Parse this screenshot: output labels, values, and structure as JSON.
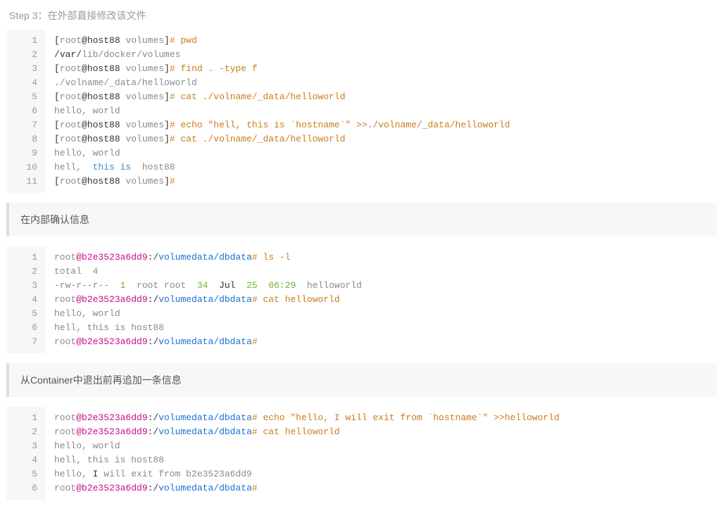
{
  "step_title": "Step 3：在外部直接修改该文件",
  "callout1": "在内部确认信息",
  "callout2": "从Container中退出前再追加一条信息",
  "block1": {
    "lines": [
      [
        {
          "cls": "tok-bracket",
          "t": "["
        },
        {
          "cls": "tok-grey mono-small",
          "t": "root"
        },
        {
          "cls": "tok-at",
          "t": "@host88 "
        },
        {
          "cls": "tok-grey mono-small",
          "t": "volumes"
        },
        {
          "cls": "tok-bracket",
          "t": "]"
        },
        {
          "cls": "tok-hash",
          "t": "# "
        },
        {
          "cls": "tok-cmd",
          "t": "pwd"
        }
      ],
      [
        {
          "cls": "tok-plain",
          "t": "/"
        },
        {
          "cls": "tok-plain",
          "t": "var"
        },
        {
          "cls": "tok-plain",
          "t": "/"
        },
        {
          "cls": "tok-grey mono-small",
          "t": "lib/docker/volumes"
        }
      ],
      [
        {
          "cls": "tok-bracket",
          "t": "["
        },
        {
          "cls": "tok-grey mono-small",
          "t": "root"
        },
        {
          "cls": "tok-at",
          "t": "@host88 "
        },
        {
          "cls": "tok-grey mono-small",
          "t": "volumes"
        },
        {
          "cls": "tok-bracket",
          "t": "]"
        },
        {
          "cls": "tok-hash",
          "t": "# "
        },
        {
          "cls": "tok-cmd",
          "t": "find . -type f"
        }
      ],
      [
        {
          "cls": "tok-grey mono-small",
          "t": "./volname/_data/helloworld"
        }
      ],
      [
        {
          "cls": "tok-bracket",
          "t": "["
        },
        {
          "cls": "tok-grey mono-small",
          "t": "root"
        },
        {
          "cls": "tok-at",
          "t": "@host88 "
        },
        {
          "cls": "tok-grey mono-small",
          "t": "volumes"
        },
        {
          "cls": "tok-bracket",
          "t": "]"
        },
        {
          "cls": "tok-hash",
          "t": "# "
        },
        {
          "cls": "tok-cmd",
          "t": "cat ./volname/_data/helloworld"
        }
      ],
      [
        {
          "cls": "tok-grey mono-small",
          "t": "hello, world"
        }
      ],
      [
        {
          "cls": "tok-bracket",
          "t": "["
        },
        {
          "cls": "tok-grey mono-small",
          "t": "root"
        },
        {
          "cls": "tok-at",
          "t": "@host88 "
        },
        {
          "cls": "tok-grey mono-small",
          "t": "volumes"
        },
        {
          "cls": "tok-bracket",
          "t": "]"
        },
        {
          "cls": "tok-hash",
          "t": "# "
        },
        {
          "cls": "tok-cmd",
          "t": "echo \"hell, this is `hostname`\" >>./volname/_data/helloworld"
        }
      ],
      [
        {
          "cls": "tok-bracket",
          "t": "["
        },
        {
          "cls": "tok-grey mono-small",
          "t": "root"
        },
        {
          "cls": "tok-at",
          "t": "@host88 "
        },
        {
          "cls": "tok-grey mono-small",
          "t": "volumes"
        },
        {
          "cls": "tok-bracket",
          "t": "]"
        },
        {
          "cls": "tok-hash",
          "t": "# "
        },
        {
          "cls": "tok-cmd",
          "t": "cat ./volname/_data/helloworld"
        }
      ],
      [
        {
          "cls": "tok-grey mono-small",
          "t": "hello, world"
        }
      ],
      [
        {
          "cls": "tok-grey mono-small",
          "t": "hell, "
        },
        {
          "cls": "tok-kw",
          "t": " this"
        },
        {
          "cls": "tok-kw",
          "t": " is "
        },
        {
          "cls": "tok-grey mono-small",
          "t": " host88"
        }
      ],
      [
        {
          "cls": "tok-bracket",
          "t": "["
        },
        {
          "cls": "tok-grey mono-small",
          "t": "root"
        },
        {
          "cls": "tok-at",
          "t": "@host88 "
        },
        {
          "cls": "tok-grey mono-small",
          "t": "volumes"
        },
        {
          "cls": "tok-bracket",
          "t": "]"
        },
        {
          "cls": "tok-hash",
          "t": "#"
        }
      ]
    ]
  },
  "block2": {
    "lines": [
      [
        {
          "cls": "tok-grey mono-small",
          "t": "root"
        },
        {
          "cls": "tok-host",
          "t": "@b2e3523a6dd9"
        },
        {
          "cls": "tok-plain",
          "t": ":/"
        },
        {
          "cls": "tok-path",
          "t": "volumedata/dbdata"
        },
        {
          "cls": "tok-hash",
          "t": "# "
        },
        {
          "cls": "tok-cmd",
          "t": "ls -l"
        }
      ],
      [
        {
          "cls": "tok-grey mono-small",
          "t": "total "
        },
        {
          "cls": "tok-num",
          "t": " 4"
        }
      ],
      [
        {
          "cls": "tok-grey mono-small",
          "t": "-rw-r--r-- "
        },
        {
          "cls": "tok-num",
          "t": " 1 "
        },
        {
          "cls": "tok-grey mono-small",
          "t": " root root "
        },
        {
          "cls": "tok-num",
          "t": " 34 "
        },
        {
          "cls": "tok-plain",
          "t": " Jul "
        },
        {
          "cls": "tok-num",
          "t": " 25 "
        },
        {
          "cls": "tok-num",
          "t": " 06:29 "
        },
        {
          "cls": "tok-grey mono-small",
          "t": " helloworld"
        }
      ],
      [
        {
          "cls": "tok-grey mono-small",
          "t": "root"
        },
        {
          "cls": "tok-host",
          "t": "@b2e3523a6dd9"
        },
        {
          "cls": "tok-plain",
          "t": ":/"
        },
        {
          "cls": "tok-path",
          "t": "volumedata/dbdata"
        },
        {
          "cls": "tok-hash",
          "t": "# "
        },
        {
          "cls": "tok-cmd",
          "t": "cat helloworld"
        }
      ],
      [
        {
          "cls": "tok-grey mono-small",
          "t": "hello, world"
        }
      ],
      [
        {
          "cls": "tok-grey mono-small",
          "t": "hell, this is host88"
        }
      ],
      [
        {
          "cls": "tok-grey mono-small",
          "t": "root"
        },
        {
          "cls": "tok-host",
          "t": "@b2e3523a6dd9"
        },
        {
          "cls": "tok-plain",
          "t": ":/"
        },
        {
          "cls": "tok-path",
          "t": "volumedata/dbdata"
        },
        {
          "cls": "tok-hash",
          "t": "#"
        }
      ]
    ]
  },
  "block3": {
    "lines": [
      [
        {
          "cls": "tok-grey mono-small",
          "t": "root"
        },
        {
          "cls": "tok-host",
          "t": "@b2e3523a6dd9"
        },
        {
          "cls": "tok-plain",
          "t": ":/"
        },
        {
          "cls": "tok-path",
          "t": "volumedata/dbdata"
        },
        {
          "cls": "tok-hash",
          "t": "# "
        },
        {
          "cls": "tok-cmd",
          "t": "echo \"hello, I will exit from `hostname`\" >>helloworld"
        }
      ],
      [
        {
          "cls": "tok-grey mono-small",
          "t": "root"
        },
        {
          "cls": "tok-host",
          "t": "@b2e3523a6dd9"
        },
        {
          "cls": "tok-plain",
          "t": ":/"
        },
        {
          "cls": "tok-path",
          "t": "volumedata/dbdata"
        },
        {
          "cls": "tok-hash",
          "t": "# "
        },
        {
          "cls": "tok-cmd",
          "t": "cat helloworld"
        }
      ],
      [
        {
          "cls": "tok-grey mono-small",
          "t": "hello, world"
        }
      ],
      [
        {
          "cls": "tok-grey mono-small",
          "t": "hell, this is host88"
        }
      ],
      [
        {
          "cls": "tok-grey mono-small",
          "t": "hello, "
        },
        {
          "cls": "tok-plain",
          "t": "I"
        },
        {
          "cls": "tok-grey mono-small",
          "t": " will exit from b2e3523a6dd9"
        }
      ],
      [
        {
          "cls": "tok-grey mono-small",
          "t": "root"
        },
        {
          "cls": "tok-host",
          "t": "@b2e3523a6dd9"
        },
        {
          "cls": "tok-plain",
          "t": ":/"
        },
        {
          "cls": "tok-path",
          "t": "volumedata/dbdata"
        },
        {
          "cls": "tok-hash",
          "t": "#"
        }
      ]
    ]
  }
}
